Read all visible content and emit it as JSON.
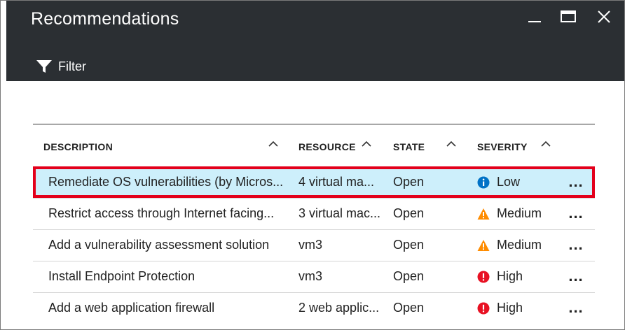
{
  "window": {
    "title": "Recommendations",
    "toolbar_filter_label": "Filter"
  },
  "table": {
    "headers": {
      "description": "DESCRIPTION",
      "resource": "RESOURCE",
      "state": "STATE",
      "severity": "SEVERITY"
    },
    "rows": [
      {
        "description": "Remediate OS vulnerabilities (by Micros...",
        "resource": "4 virtual ma...",
        "state": "Open",
        "severity": "Low",
        "severity_icon": "info-icon",
        "more": "...",
        "selected": true
      },
      {
        "description": "Restrict access through Internet facing...",
        "resource": "3 virtual mac...",
        "state": "Open",
        "severity": "Medium",
        "severity_icon": "warning-icon",
        "more": "...",
        "selected": false
      },
      {
        "description": "Add a vulnerability assessment solution",
        "resource": "vm3",
        "state": "Open",
        "severity": "Medium",
        "severity_icon": "warning-icon",
        "more": "...",
        "selected": false
      },
      {
        "description": "Install Endpoint Protection",
        "resource": "vm3",
        "state": "Open",
        "severity": "High",
        "severity_icon": "error-icon",
        "more": "...",
        "selected": false
      },
      {
        "description": "Add a web application firewall",
        "resource": "2 web applic...",
        "state": "Open",
        "severity": "High",
        "severity_icon": "error-icon",
        "more": "...",
        "selected": false
      }
    ]
  },
  "colors": {
    "header_bg": "#2b2f33",
    "selected_row_bg": "#cdeffb",
    "selected_outline": "#e3001b",
    "info_blue": "#0072c6",
    "warning_orange": "#ff8c00",
    "error_red": "#e81123"
  }
}
